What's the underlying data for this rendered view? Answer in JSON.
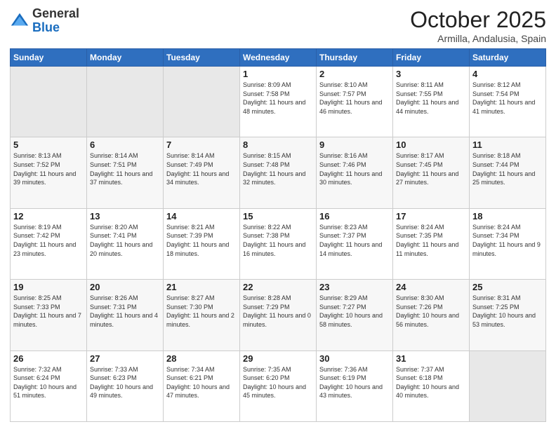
{
  "logo": {
    "general": "General",
    "blue": "Blue"
  },
  "header": {
    "title": "October 2025",
    "location": "Armilla, Andalusia, Spain"
  },
  "days": [
    "Sunday",
    "Monday",
    "Tuesday",
    "Wednesday",
    "Thursday",
    "Friday",
    "Saturday"
  ],
  "weeks": [
    [
      {
        "day": null
      },
      {
        "day": null
      },
      {
        "day": null
      },
      {
        "day": "1",
        "sunrise": "8:09 AM",
        "sunset": "7:58 PM",
        "daylight": "11 hours and 48 minutes."
      },
      {
        "day": "2",
        "sunrise": "8:10 AM",
        "sunset": "7:57 PM",
        "daylight": "11 hours and 46 minutes."
      },
      {
        "day": "3",
        "sunrise": "8:11 AM",
        "sunset": "7:55 PM",
        "daylight": "11 hours and 44 minutes."
      },
      {
        "day": "4",
        "sunrise": "8:12 AM",
        "sunset": "7:54 PM",
        "daylight": "11 hours and 41 minutes."
      }
    ],
    [
      {
        "day": "5",
        "sunrise": "8:13 AM",
        "sunset": "7:52 PM",
        "daylight": "11 hours and 39 minutes."
      },
      {
        "day": "6",
        "sunrise": "8:14 AM",
        "sunset": "7:51 PM",
        "daylight": "11 hours and 37 minutes."
      },
      {
        "day": "7",
        "sunrise": "8:14 AM",
        "sunset": "7:49 PM",
        "daylight": "11 hours and 34 minutes."
      },
      {
        "day": "8",
        "sunrise": "8:15 AM",
        "sunset": "7:48 PM",
        "daylight": "11 hours and 32 minutes."
      },
      {
        "day": "9",
        "sunrise": "8:16 AM",
        "sunset": "7:46 PM",
        "daylight": "11 hours and 30 minutes."
      },
      {
        "day": "10",
        "sunrise": "8:17 AM",
        "sunset": "7:45 PM",
        "daylight": "11 hours and 27 minutes."
      },
      {
        "day": "11",
        "sunrise": "8:18 AM",
        "sunset": "7:44 PM",
        "daylight": "11 hours and 25 minutes."
      }
    ],
    [
      {
        "day": "12",
        "sunrise": "8:19 AM",
        "sunset": "7:42 PM",
        "daylight": "11 hours and 23 minutes."
      },
      {
        "day": "13",
        "sunrise": "8:20 AM",
        "sunset": "7:41 PM",
        "daylight": "11 hours and 20 minutes."
      },
      {
        "day": "14",
        "sunrise": "8:21 AM",
        "sunset": "7:39 PM",
        "daylight": "11 hours and 18 minutes."
      },
      {
        "day": "15",
        "sunrise": "8:22 AM",
        "sunset": "7:38 PM",
        "daylight": "11 hours and 16 minutes."
      },
      {
        "day": "16",
        "sunrise": "8:23 AM",
        "sunset": "7:37 PM",
        "daylight": "11 hours and 14 minutes."
      },
      {
        "day": "17",
        "sunrise": "8:24 AM",
        "sunset": "7:35 PM",
        "daylight": "11 hours and 11 minutes."
      },
      {
        "day": "18",
        "sunrise": "8:24 AM",
        "sunset": "7:34 PM",
        "daylight": "11 hours and 9 minutes."
      }
    ],
    [
      {
        "day": "19",
        "sunrise": "8:25 AM",
        "sunset": "7:33 PM",
        "daylight": "11 hours and 7 minutes."
      },
      {
        "day": "20",
        "sunrise": "8:26 AM",
        "sunset": "7:31 PM",
        "daylight": "11 hours and 4 minutes."
      },
      {
        "day": "21",
        "sunrise": "8:27 AM",
        "sunset": "7:30 PM",
        "daylight": "11 hours and 2 minutes."
      },
      {
        "day": "22",
        "sunrise": "8:28 AM",
        "sunset": "7:29 PM",
        "daylight": "11 hours and 0 minutes."
      },
      {
        "day": "23",
        "sunrise": "8:29 AM",
        "sunset": "7:27 PM",
        "daylight": "10 hours and 58 minutes."
      },
      {
        "day": "24",
        "sunrise": "8:30 AM",
        "sunset": "7:26 PM",
        "daylight": "10 hours and 56 minutes."
      },
      {
        "day": "25",
        "sunrise": "8:31 AM",
        "sunset": "7:25 PM",
        "daylight": "10 hours and 53 minutes."
      }
    ],
    [
      {
        "day": "26",
        "sunrise": "7:32 AM",
        "sunset": "6:24 PM",
        "daylight": "10 hours and 51 minutes."
      },
      {
        "day": "27",
        "sunrise": "7:33 AM",
        "sunset": "6:23 PM",
        "daylight": "10 hours and 49 minutes."
      },
      {
        "day": "28",
        "sunrise": "7:34 AM",
        "sunset": "6:21 PM",
        "daylight": "10 hours and 47 minutes."
      },
      {
        "day": "29",
        "sunrise": "7:35 AM",
        "sunset": "6:20 PM",
        "daylight": "10 hours and 45 minutes."
      },
      {
        "day": "30",
        "sunrise": "7:36 AM",
        "sunset": "6:19 PM",
        "daylight": "10 hours and 43 minutes."
      },
      {
        "day": "31",
        "sunrise": "7:37 AM",
        "sunset": "6:18 PM",
        "daylight": "10 hours and 40 minutes."
      },
      {
        "day": null
      }
    ]
  ]
}
